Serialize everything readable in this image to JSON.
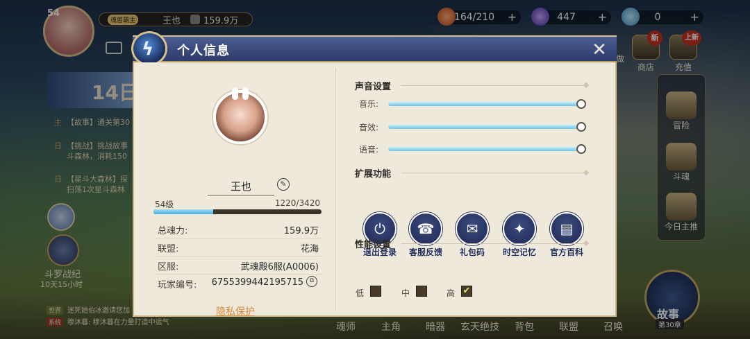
{
  "hud": {
    "level": "54",
    "title_badge": "魂兽霸主",
    "player_name": "王也",
    "power": "159.9万",
    "resources": [
      {
        "icon": "stamina-icon",
        "value": "164/210"
      },
      {
        "icon": "crystal-icon",
        "value": "447"
      },
      {
        "icon": "diamond-icon",
        "value": "0"
      }
    ],
    "shop_label": "商店",
    "recharge_label": "充值",
    "new_badge": "新",
    "new_badge_2": "上新",
    "partial_top_label": "做"
  },
  "left_panel": {
    "hero_banner_text": "14日",
    "chat": [
      {
        "tag": "主",
        "text": "【故事】通关第30"
      },
      {
        "tag": "日",
        "text": "【挑战】挑战故事"
      },
      {
        "tag": "",
        "text": "斗森林，消耗150"
      },
      {
        "tag": "日",
        "text": "【星斗大森林】探"
      },
      {
        "tag": "",
        "text": "扫荡1次星斗森林"
      }
    ],
    "event_name": "斗罗战纪",
    "event_timer": "10天15小时"
  },
  "bottom_chat": [
    {
      "channel": "世界",
      "text": "迷死她伯冰邀请您加"
    },
    {
      "channel": "系统",
      "text": "穆沐暮:  穆沐暮在力量打造中运气"
    }
  ],
  "right_rail": [
    "冒险",
    "斗魂",
    "今日主推"
  ],
  "story": {
    "label": "故事",
    "chapter": "第30章"
  },
  "bottom_nav": [
    "魂师",
    "主角",
    "暗器",
    "玄天绝技",
    "背包",
    "联盟",
    "召唤"
  ],
  "dialog": {
    "title": "个人信息",
    "profile": {
      "name": "王也",
      "level_label": "54级",
      "exp": "1220/3420",
      "exp_progress": 0.357,
      "rows": [
        {
          "key": "总魂力:",
          "value": "159.9万"
        },
        {
          "key": "联盟:",
          "value": "花海"
        },
        {
          "key": "区服:",
          "value": "武魂殿6服(A0006)"
        },
        {
          "key": "玩家编号:",
          "value": "6755399442195715"
        }
      ],
      "privacy_link": "隐私保护"
    },
    "sound": {
      "title": "声音设置",
      "sliders": [
        {
          "label": "音乐:",
          "level": 1.0
        },
        {
          "label": "音效:",
          "level": 1.0
        },
        {
          "label": "语音:",
          "level": 1.0
        }
      ]
    },
    "features": {
      "title": "扩展功能",
      "items": [
        {
          "label": "退出登录",
          "icon": "logout-icon",
          "glyph": "⏻"
        },
        {
          "label": "客服反馈",
          "icon": "headset-icon",
          "glyph": "☎"
        },
        {
          "label": "礼包码",
          "icon": "gift-bag-icon",
          "glyph": "✉"
        },
        {
          "label": "时空记忆",
          "icon": "star-compass-icon",
          "glyph": "✦"
        },
        {
          "label": "官方百科",
          "icon": "book-icon",
          "glyph": "▤"
        }
      ]
    },
    "performance": {
      "title": "性能设置",
      "options": [
        {
          "label": "低",
          "checked": false
        },
        {
          "label": "中",
          "checked": false
        },
        {
          "label": "高",
          "checked": true
        }
      ]
    }
  }
}
